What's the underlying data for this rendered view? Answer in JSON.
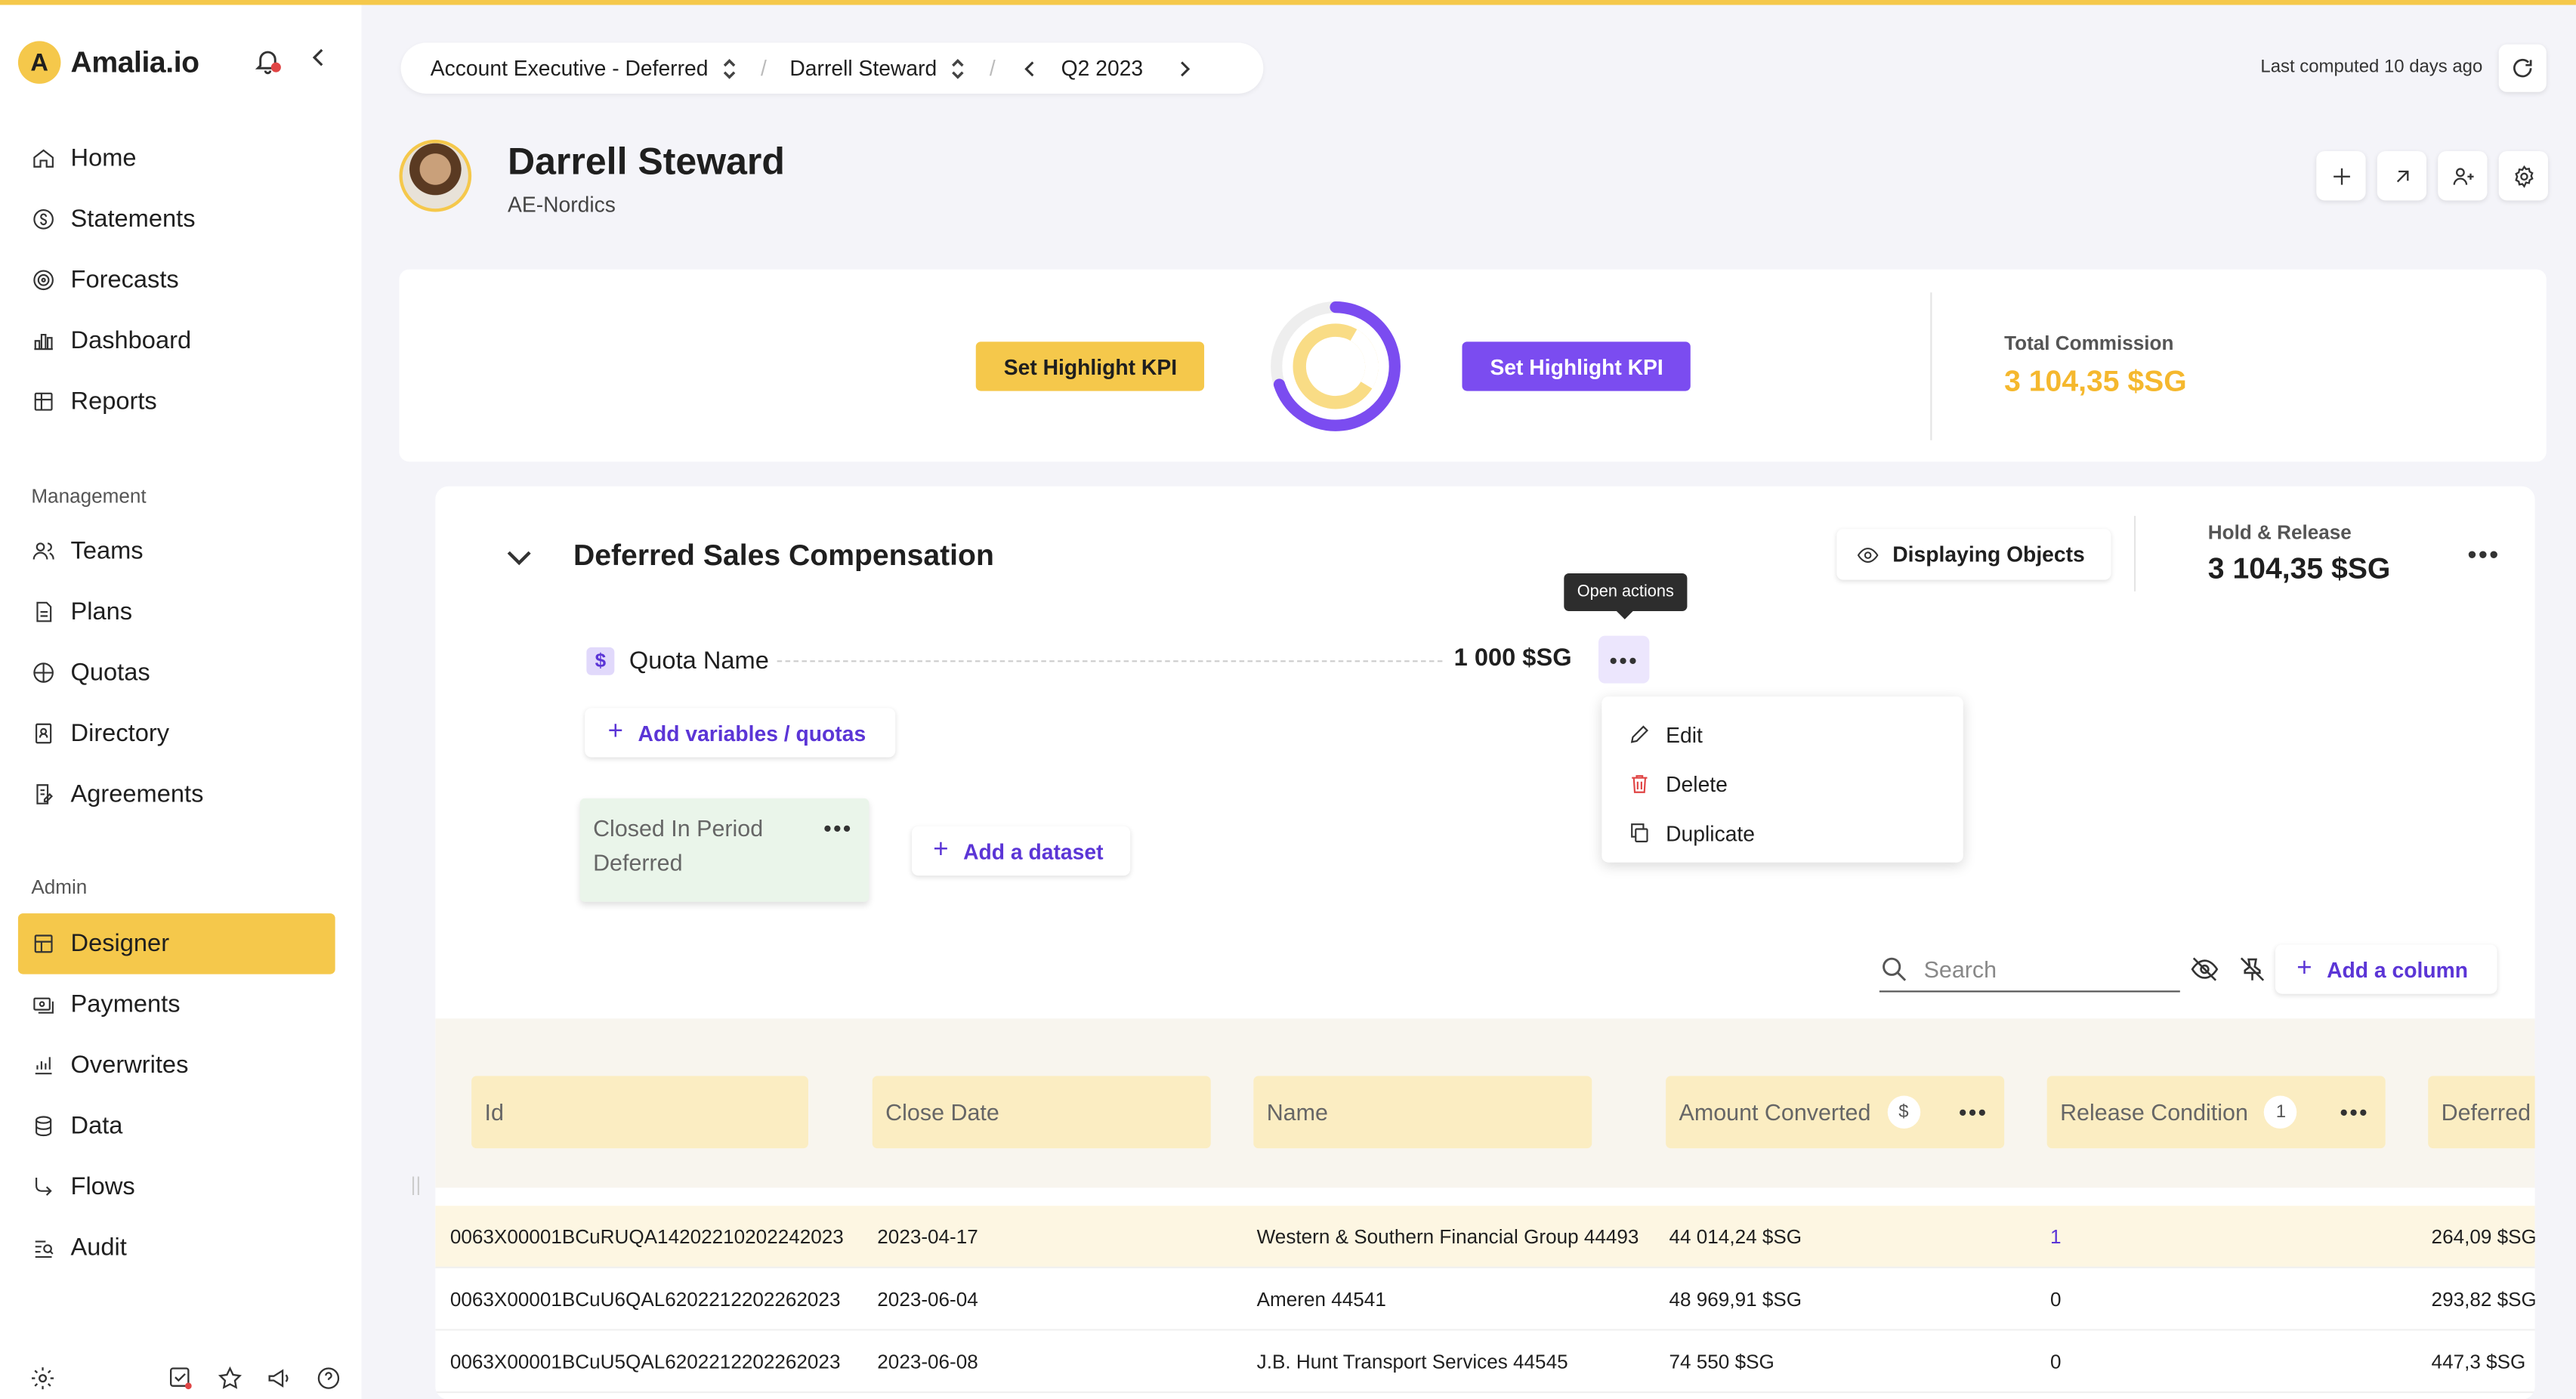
{
  "app": {
    "brand_letter": "A",
    "brand_name": "Amalia.io"
  },
  "sidebar": {
    "main_items": [
      {
        "label": "Home",
        "icon": "home-icon"
      },
      {
        "label": "Statements",
        "icon": "statements-icon"
      },
      {
        "label": "Forecasts",
        "icon": "forecasts-icon"
      },
      {
        "label": "Dashboard",
        "icon": "dashboard-icon"
      },
      {
        "label": "Reports",
        "icon": "reports-icon"
      }
    ],
    "management_label": "Management",
    "management_items": [
      {
        "label": "Teams",
        "icon": "teams-icon"
      },
      {
        "label": "Plans",
        "icon": "plans-icon"
      },
      {
        "label": "Quotas",
        "icon": "quotas-icon"
      },
      {
        "label": "Directory",
        "icon": "directory-icon"
      },
      {
        "label": "Agreements",
        "icon": "agreements-icon"
      }
    ],
    "admin_label": "Admin",
    "admin_items": [
      {
        "label": "Designer",
        "icon": "designer-icon",
        "active": true
      },
      {
        "label": "Payments",
        "icon": "payments-icon"
      },
      {
        "label": "Overwrites",
        "icon": "overwrites-icon"
      },
      {
        "label": "Data",
        "icon": "data-icon"
      },
      {
        "label": "Flows",
        "icon": "flows-icon"
      },
      {
        "label": "Audit",
        "icon": "audit-icon"
      }
    ]
  },
  "header": {
    "plan": "Account Executive - Deferred",
    "user": "Darrell Steward",
    "period": "Q2 2023",
    "last_computed": "Last computed 10 days ago"
  },
  "person": {
    "name": "Darrell Steward",
    "team": "AE-Nordics"
  },
  "kpi": {
    "highlight_left": "Set Highlight KPI",
    "highlight_right": "Set Highlight KPI",
    "total_commission_label": "Total Commission",
    "total_commission_value": "3 104,35 $SG",
    "donut_progress": 0.7
  },
  "section": {
    "title": "Deferred Sales Compensation",
    "displaying_objects": "Displaying Objects",
    "hold_release_label": "Hold & Release",
    "hold_release_value": "3 104,35 $SG",
    "quota_badge": "$",
    "quota_name": "Quota Name",
    "quota_value": "1 000 $SG",
    "tooltip": "Open actions",
    "add_variables": "Add variables / quotas",
    "dataset_name": "Closed In Period",
    "dataset_sub": "Deferred",
    "add_dataset": "Add a dataset",
    "menu": {
      "edit": "Edit",
      "delete": "Delete",
      "duplicate": "Duplicate"
    },
    "search_placeholder": "Search",
    "add_column": "Add a column"
  },
  "table": {
    "columns": {
      "id": "Id",
      "close_date": "Close Date",
      "name": "Name",
      "amount": "Amount Converted",
      "amount_badge": "$",
      "release": "Release Condition",
      "release_badge": "1",
      "deferred": "Deferred"
    },
    "rows": [
      {
        "id": "0063X00001BCuRUQA14202210202242023",
        "date": "2023-04-17",
        "name": "Western & Southern Financial Group 44493",
        "amount": "44 014,24 $SG",
        "release": "1",
        "deferred": "264,09 $SG"
      },
      {
        "id": "0063X00001BCuU6QAL6202212202262023",
        "date": "2023-06-04",
        "name": "Ameren 44541",
        "amount": "48 969,91 $SG",
        "release": "0",
        "deferred": "293,82 $SG"
      },
      {
        "id": "0063X00001BCuU5QAL6202212202262023",
        "date": "2023-06-08",
        "name": "J.B. Hunt Transport Services 44545",
        "amount": "74 550 $SG",
        "release": "0",
        "deferred": "447,3 $SG"
      }
    ]
  },
  "colors": {
    "accent_yellow": "#f5c84b",
    "accent_purple": "#7b4cf0",
    "commission": "#f5b82e"
  }
}
